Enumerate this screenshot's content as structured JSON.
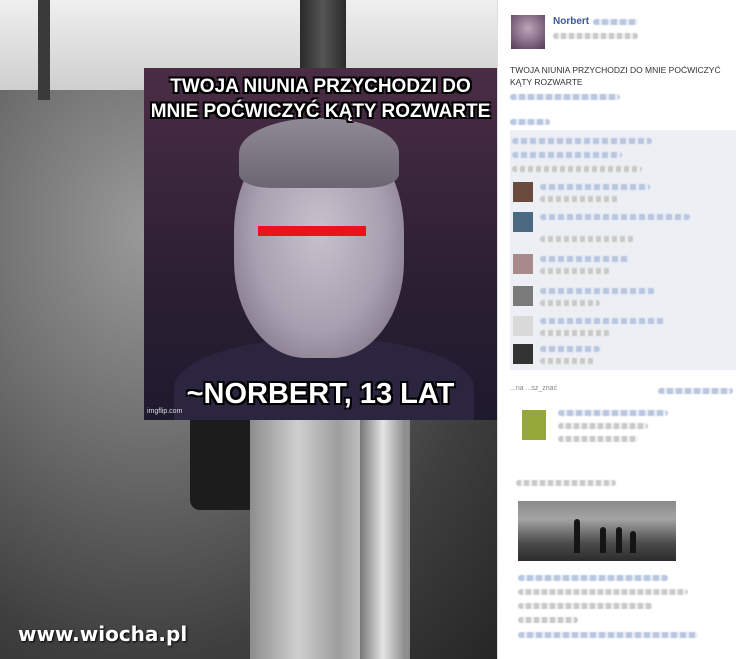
{
  "meme": {
    "top_text": "TWOJA NIUNIA PRZYCHODZI DO MNIE POĆWICZYĆ KĄTY ROZWARTE",
    "bottom_text": "~NORBERT, 13 LAT",
    "source_mark": "imgflip.com"
  },
  "watermark": "www.wiocha.pl",
  "post": {
    "author": "Norbert",
    "text": "TWOJA NIUNIA PRZYCHODZI DO MNIE POĆWICZYĆ KĄTY ROZWARTE",
    "comment_label": "...na ...sz_znać"
  },
  "colors": {
    "censor_bar": "#e8141a",
    "link_blue": "#3b5998"
  }
}
